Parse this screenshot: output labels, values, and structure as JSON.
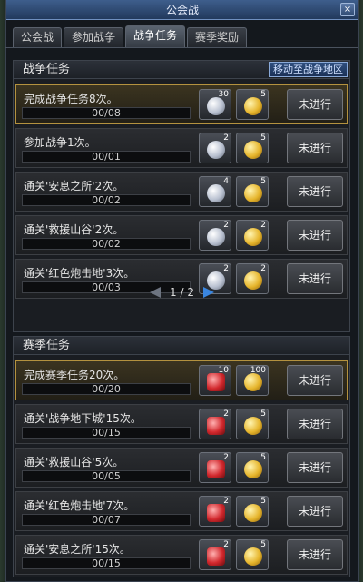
{
  "window": {
    "title": "公会战",
    "close_icon": "×"
  },
  "tabs": [
    {
      "label": "公会战"
    },
    {
      "label": "参加战争"
    },
    {
      "label": "战争任务"
    },
    {
      "label": "赛季奖励"
    }
  ],
  "war_tasks": {
    "header": "战争任务",
    "move_button": "移动至战争地区",
    "rows": [
      {
        "name": "完成战争任务8次。",
        "progress": "00/08",
        "reward1_count": "30",
        "reward2_count": "5",
        "status": "未进行"
      },
      {
        "name": "参加战争1次。",
        "progress": "00/01",
        "reward1_count": "2",
        "reward2_count": "5",
        "status": "未进行"
      },
      {
        "name": "通关'安息之所'2次。",
        "progress": "00/02",
        "reward1_count": "4",
        "reward2_count": "5",
        "status": "未进行"
      },
      {
        "name": "通关'救援山谷'2次。",
        "progress": "00/02",
        "reward1_count": "2",
        "reward2_count": "2",
        "status": "未进行"
      },
      {
        "name": "通关'红色炮击地'3次。",
        "progress": "00/03",
        "reward1_count": "2",
        "reward2_count": "2",
        "status": "未进行"
      }
    ],
    "pager": {
      "current": "1",
      "separator": "/",
      "total": "2"
    }
  },
  "season_tasks": {
    "header": "赛季任务",
    "rows": [
      {
        "name": "完成赛季任务20次。",
        "progress": "00/20",
        "reward1_count": "10",
        "reward2_count": "100",
        "status": "未进行"
      },
      {
        "name": "通关'战争地下城'15次。",
        "progress": "00/15",
        "reward1_count": "2",
        "reward2_count": "5",
        "status": "未进行"
      },
      {
        "name": "通关'救援山谷'5次。",
        "progress": "00/05",
        "reward1_count": "2",
        "reward2_count": "5",
        "status": "未进行"
      },
      {
        "name": "通关'红色炮击地'7次。",
        "progress": "00/07",
        "reward1_count": "2",
        "reward2_count": "5",
        "status": "未进行"
      },
      {
        "name": "通关'安息之所'15次。",
        "progress": "00/15",
        "reward1_count": "2",
        "reward2_count": "5",
        "status": "未进行"
      }
    ]
  }
}
